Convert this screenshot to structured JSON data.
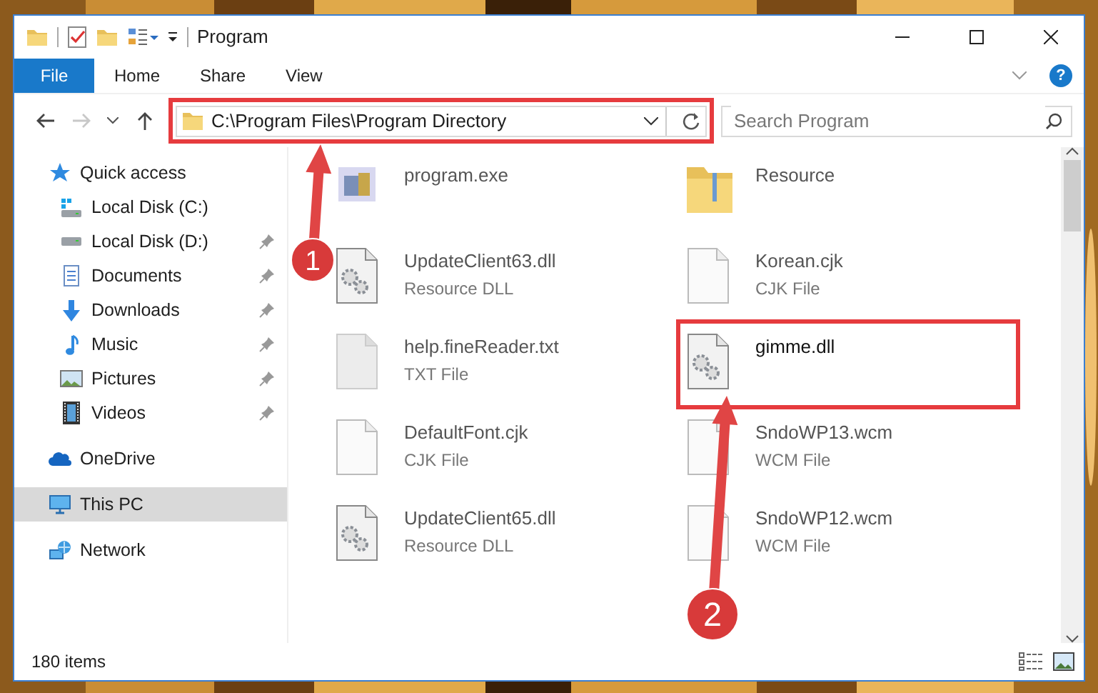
{
  "window": {
    "title": "Program"
  },
  "ribbon": {
    "tabs": [
      {
        "label": "File",
        "kind": "file"
      },
      {
        "label": "Home",
        "kind": "tab"
      },
      {
        "label": "Share",
        "kind": "tab"
      },
      {
        "label": "View",
        "kind": "tab"
      }
    ],
    "help": "?"
  },
  "address_bar": {
    "path": "C:\\Program Files\\Program Directory",
    "forward_disabled": true
  },
  "search": {
    "placeholder": "Search Program"
  },
  "sidebar": {
    "items": [
      {
        "label": "Quick access",
        "selected": false,
        "children": [
          {
            "label": "Local Disk (C:)",
            "selected": false
          },
          {
            "label": "Local Disk (D:)",
            "pinned": true,
            "selected": false
          },
          {
            "label": "Documents",
            "pinned": true,
            "selected": false
          },
          {
            "label": "Downloads",
            "pinned": true,
            "selected": false
          },
          {
            "label": "Music",
            "pinned": true,
            "selected": false
          },
          {
            "label": "Pictures",
            "pinned": true,
            "selected": false
          },
          {
            "label": "Videos",
            "pinned": true,
            "selected": false
          }
        ]
      },
      {
        "label": "OneDrive",
        "selected": false
      },
      {
        "label": "This PC",
        "selected": true
      },
      {
        "label": "Network",
        "selected": false
      }
    ]
  },
  "files": [
    {
      "name": "program.exe",
      "kind": "exe"
    },
    {
      "name": "Resource",
      "kind": "folder"
    },
    {
      "name": "UpdateClient63.dll",
      "type": "Resource DLL",
      "kind": "dll"
    },
    {
      "name": "Korean.cjk",
      "type": "CJK File",
      "kind": "file"
    },
    {
      "name": "help.fineReader.txt",
      "type": "TXT File",
      "kind": "txt"
    },
    {
      "name": "gimme.dll",
      "kind": "dll"
    },
    {
      "name": "DefaultFont.cjk",
      "type": "CJK File",
      "kind": "file"
    },
    {
      "name": "SndoWP13.wcm",
      "type": "WCM File",
      "kind": "file"
    },
    {
      "name": "UpdateClient65.dll",
      "type": "Resource DLL",
      "kind": "dll"
    },
    {
      "name": "SndoWP12.wcm",
      "type": "WCM File",
      "kind": "file"
    }
  ],
  "status_bar": {
    "count": "180 items"
  },
  "annotations": [
    {
      "label": "1"
    },
    {
      "label": "2"
    }
  ]
}
